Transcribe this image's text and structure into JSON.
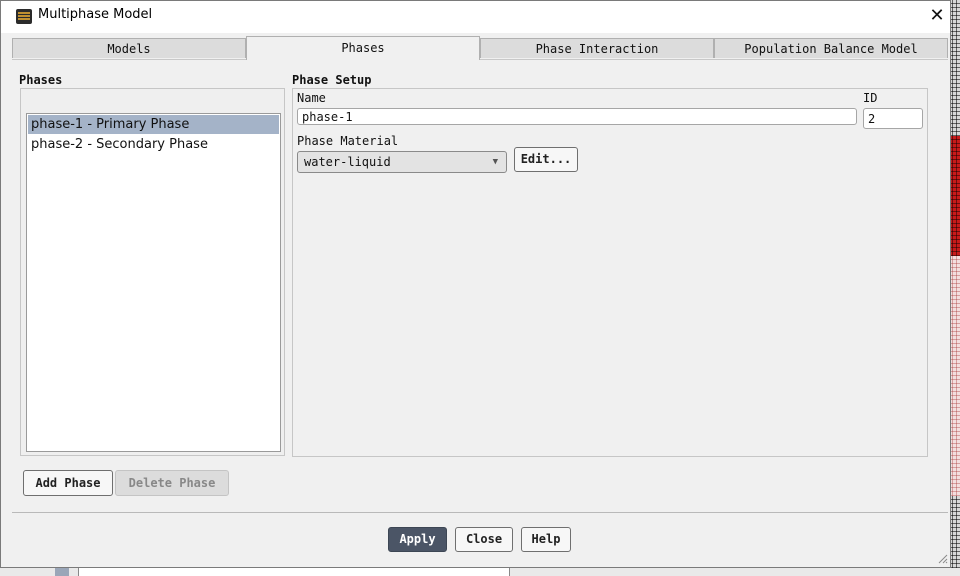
{
  "window": {
    "title": "Multiphase Model",
    "close_glyph": "✕"
  },
  "tabs": [
    {
      "label": "Models",
      "active": false
    },
    {
      "label": "Phases",
      "active": true
    },
    {
      "label": "Phase Interaction",
      "active": false
    },
    {
      "label": "Population Balance Model",
      "active": false
    }
  ],
  "phases": {
    "group_label": "Phases",
    "items": [
      {
        "label": "phase-1 - Primary Phase",
        "selected": true
      },
      {
        "label": "phase-2 - Secondary Phase",
        "selected": false
      }
    ],
    "add_label": "Add Phase",
    "delete_label": "Delete Phase"
  },
  "setup": {
    "group_label": "Phase Setup",
    "name_label": "Name",
    "name_value": "phase-1",
    "id_label": "ID",
    "id_value": "2",
    "material_label": "Phase Material",
    "material_value": "water-liquid",
    "edit_label": "Edit..."
  },
  "footer": {
    "apply_label": "Apply",
    "close_label": "Close",
    "help_label": "Help"
  },
  "colors": {
    "selection": "#a4b3c8",
    "apply_button": "#4b5566"
  }
}
